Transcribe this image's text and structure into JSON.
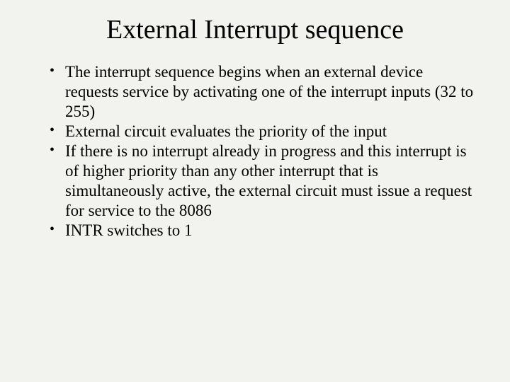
{
  "slide": {
    "title": "External Interrupt sequence",
    "bullets": [
      "The interrupt sequence begins when an external device requests service by activating one of the interrupt inputs (32 to 255)",
      "External circuit evaluates the priority of the input",
      "If there is no interrupt already in progress and this interrupt is of higher priority than any other interrupt that is simultaneously active, the external circuit must issue a request for service to the 8086",
      "INTR switches to 1"
    ]
  }
}
